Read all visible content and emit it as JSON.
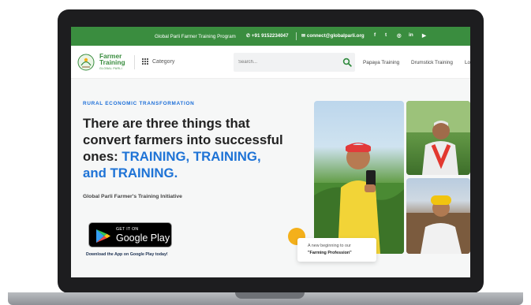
{
  "topbar": {
    "title": "Global Parli Farmer Training Program",
    "phone": "+91 9152234047",
    "email": "connect@globalparli.org",
    "social": [
      "facebook-icon",
      "twitter-icon",
      "instagram-icon",
      "linkedin-icon",
      "youtube-icon"
    ],
    "social_glyphs": [
      "f",
      "t",
      "◎",
      "in",
      "▶"
    ],
    "bg": "#3a8d3f"
  },
  "nav": {
    "logo_line1": "Farmer",
    "logo_line2": "Training",
    "logo_line3": "GLOBAL PARLI",
    "category_label": "Category",
    "search_placeholder": "Search...",
    "links": [
      "Papaya Training",
      "Drumstick Training",
      "Lo"
    ]
  },
  "hero": {
    "kicker": "RURAL ECONOMIC TRANSFORMATION",
    "headline_part1": "There are three things that convert farmers into successful ones: ",
    "headline_part2": "TRAINING, TRAINING, and TRAINING.",
    "subtitle": "Global Parli Farmer's Training Initiative",
    "gplay_small": "GET IT ON",
    "gplay_big": "Google Play",
    "download_text": "Download the App on Google Play today!",
    "card_line1": "A new beginning to our",
    "card_line2": "\"Farming Profession\"",
    "accent": "#1e73d6"
  }
}
